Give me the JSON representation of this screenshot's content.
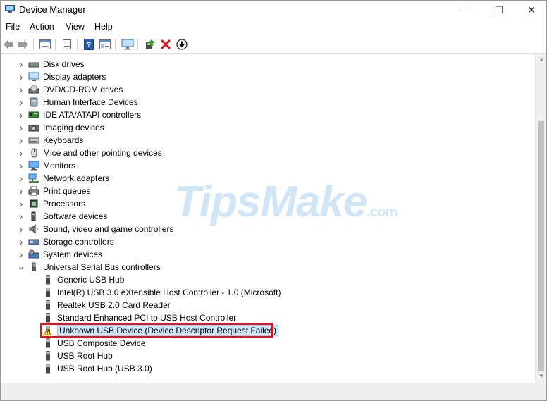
{
  "window": {
    "title": "Device Manager"
  },
  "controls": {
    "minimize": "—",
    "maximize": "☐",
    "close": "✕"
  },
  "menu": [
    "File",
    "Action",
    "View",
    "Help"
  ],
  "toolbar_icons": [
    "back-icon",
    "forward-icon",
    "properties-grid-icon",
    "list-icon",
    "help-icon",
    "details-icon",
    "monitor-icon",
    "update-driver-icon",
    "uninstall-icon",
    "download-icon"
  ],
  "tree": {
    "categories": [
      {
        "label": "Disk drives",
        "icon": "disk-drive-icon"
      },
      {
        "label": "Display adapters",
        "icon": "display-adapter-icon"
      },
      {
        "label": "DVD/CD-ROM drives",
        "icon": "dvd-drive-icon"
      },
      {
        "label": "Human Interface Devices",
        "icon": "hid-icon"
      },
      {
        "label": "IDE ATA/ATAPI controllers",
        "icon": "ide-controller-icon"
      },
      {
        "label": "Imaging devices",
        "icon": "camera-icon"
      },
      {
        "label": "Keyboards",
        "icon": "keyboard-icon"
      },
      {
        "label": "Mice and other pointing devices",
        "icon": "mouse-icon"
      },
      {
        "label": "Monitors",
        "icon": "monitor-icon"
      },
      {
        "label": "Network adapters",
        "icon": "network-icon"
      },
      {
        "label": "Print queues",
        "icon": "printer-icon"
      },
      {
        "label": "Processors",
        "icon": "processor-icon"
      },
      {
        "label": "Software devices",
        "icon": "software-device-icon"
      },
      {
        "label": "Sound, video and game controllers",
        "icon": "speaker-icon"
      },
      {
        "label": "Storage controllers",
        "icon": "storage-controller-icon"
      },
      {
        "label": "System devices",
        "icon": "system-devices-icon"
      },
      {
        "label": "Universal Serial Bus controllers",
        "icon": "usb-icon"
      }
    ],
    "usb_children": [
      {
        "label": "Generic USB Hub",
        "warning": false
      },
      {
        "label": "Intel(R) USB 3.0 eXtensible Host Controller - 1.0 (Microsoft)",
        "warning": false
      },
      {
        "label": "Realtek USB 2.0 Card Reader",
        "warning": false
      },
      {
        "label": "Standard Enhanced PCI to USB Host Controller",
        "warning": false
      },
      {
        "label": "Unknown USB Device (Device Descriptor Request Failed)",
        "warning": true
      },
      {
        "label": "USB Composite Device",
        "warning": false
      },
      {
        "label": "USB Root Hub",
        "warning": false
      },
      {
        "label": "USB Root Hub (USB 3.0)",
        "warning": false
      }
    ]
  },
  "watermark": {
    "brand": "TipsMake",
    "suffix": ".com"
  },
  "colors": {
    "selection": "#cce8ff",
    "highlight": "#e0141b",
    "watermark": "#78b4e1"
  }
}
